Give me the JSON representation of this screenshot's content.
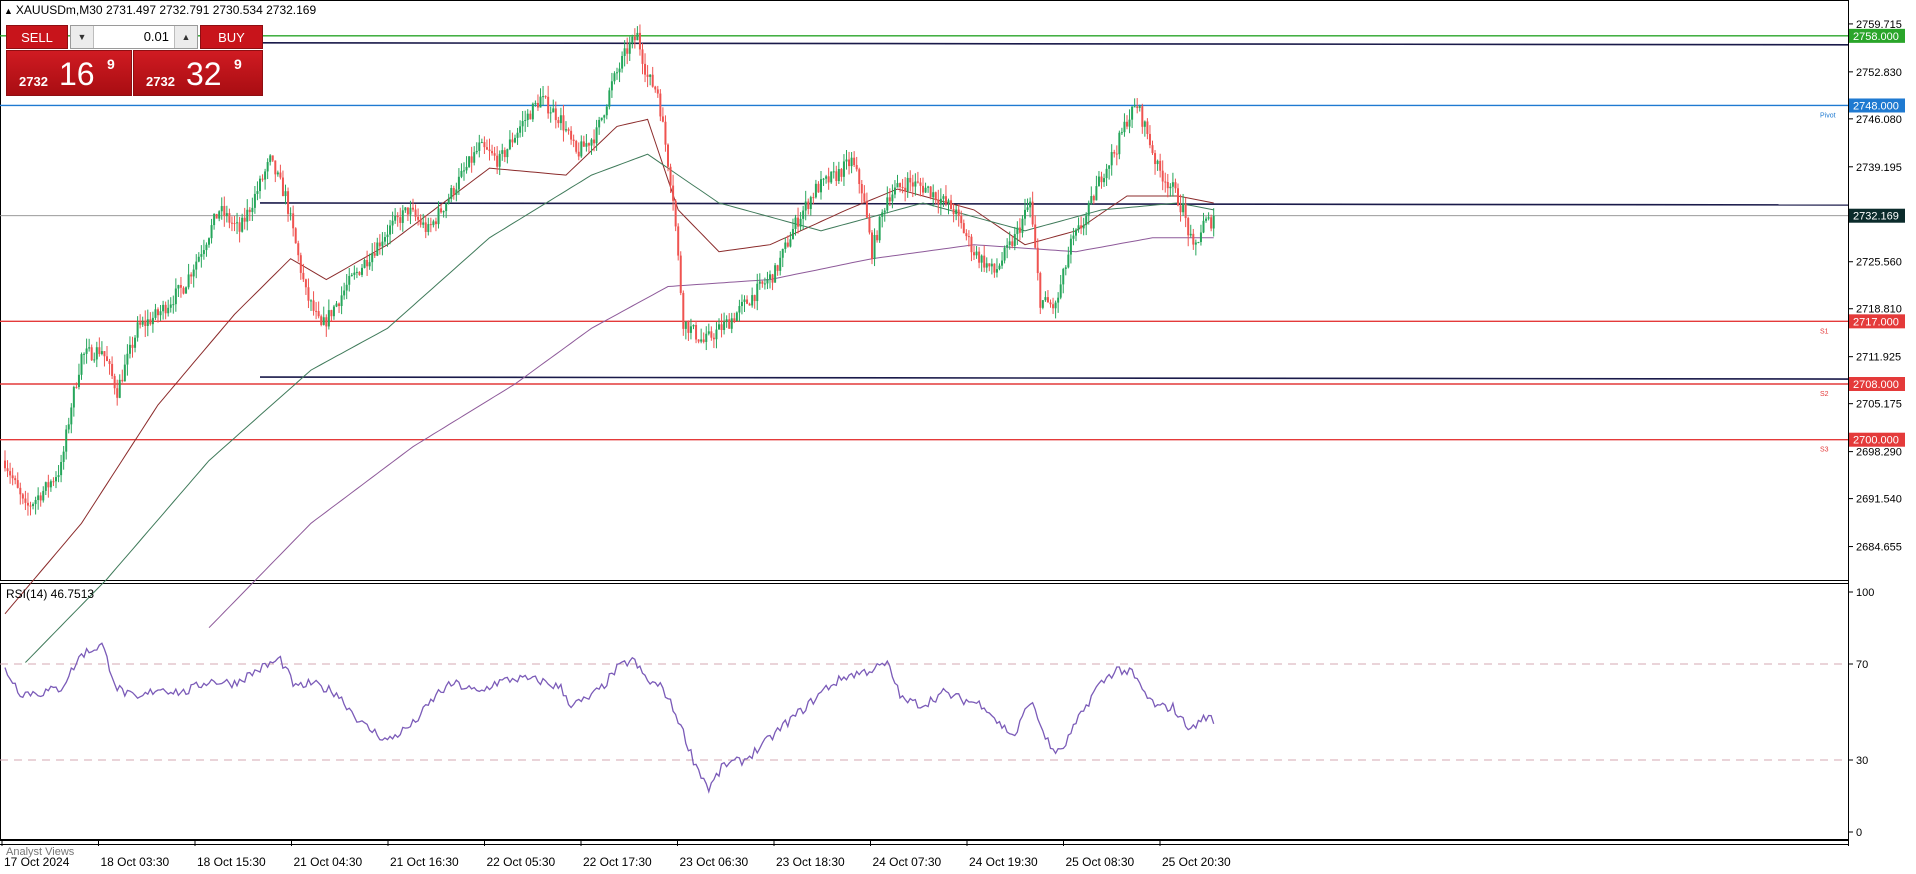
{
  "header": {
    "symbol_line": "XAUUSDm,M30  2731.497 2732.791 2730.534 2732.169"
  },
  "trade_panel": {
    "sell_label": "SELL",
    "buy_label": "BUY",
    "lot_value": "0.01",
    "sell_small": "2732",
    "sell_big": "16",
    "sell_sup": "9",
    "buy_small": "2732",
    "buy_big": "32",
    "buy_sup": "9"
  },
  "price_axis": {
    "ticks": [
      "2759.715",
      "2752.830",
      "2746.080",
      "2739.195",
      "2725.560",
      "2718.810",
      "2711.925",
      "2705.175",
      "2698.290",
      "2691.540",
      "2684.655"
    ]
  },
  "levels": [
    {
      "label": "2758.000",
      "price": 2758.0,
      "color": "#2aa52a",
      "text_label": ""
    },
    {
      "label": "2748.000",
      "price": 2748.0,
      "color": "#1f7ad1",
      "text_label": "Pivot"
    },
    {
      "label": "2717.000",
      "price": 2717.0,
      "color": "#e43a3a",
      "text_label": "S1"
    },
    {
      "label": "2708.000",
      "price": 2708.0,
      "color": "#e43a3a",
      "text_label": "S2"
    },
    {
      "label": "2700.000",
      "price": 2700.0,
      "color": "#e43a3a",
      "text_label": "S3"
    }
  ],
  "current_price": {
    "label": "2732.169",
    "price": 2732.169
  },
  "rsi": {
    "title": "RSI(14) 46.7513",
    "ticks": [
      "100",
      "70",
      "30",
      "0"
    ]
  },
  "time_axis": {
    "labels": [
      "17 Oct 2024",
      "18 Oct 03:30",
      "18 Oct 15:30",
      "21 Oct 04:30",
      "21 Oct 16:30",
      "22 Oct 05:30",
      "22 Oct 17:30",
      "23 Oct 06:30",
      "23 Oct 18:30",
      "24 Oct 07:30",
      "24 Oct 19:30",
      "25 Oct 08:30",
      "25 Oct 20:30"
    ]
  },
  "footer": {
    "analyst_label": "Analyst Views"
  },
  "colors": {
    "bull": "#26a65b",
    "bear": "#ef5350",
    "rsi": "#7b5bb8",
    "ma_fast": "#8b2b2b",
    "ma_mid": "#3f7a5a",
    "ma_slow": "#8e5a9a"
  },
  "chart_data": {
    "type": "candlestick",
    "symbol": "XAUUSDm",
    "timeframe": "M30",
    "anchors": [
      [
        0,
        2697
      ],
      [
        8,
        2690
      ],
      [
        16,
        2693
      ],
      [
        22,
        2696
      ],
      [
        26,
        2705
      ],
      [
        30,
        2712
      ],
      [
        38,
        2713
      ],
      [
        44,
        2707
      ],
      [
        52,
        2716
      ],
      [
        60,
        2718
      ],
      [
        70,
        2722
      ],
      [
        78,
        2728
      ],
      [
        84,
        2733
      ],
      [
        92,
        2730
      ],
      [
        98,
        2735
      ],
      [
        104,
        2740
      ],
      [
        110,
        2735
      ],
      [
        118,
        2721
      ],
      [
        124,
        2716
      ],
      [
        134,
        2722
      ],
      [
        142,
        2726
      ],
      [
        150,
        2730
      ],
      [
        158,
        2733
      ],
      [
        166,
        2730
      ],
      [
        176,
        2736
      ],
      [
        186,
        2742
      ],
      [
        194,
        2740
      ],
      [
        202,
        2745
      ],
      [
        210,
        2749
      ],
      [
        218,
        2746
      ],
      [
        224,
        2741
      ],
      [
        232,
        2744
      ],
      [
        238,
        2751
      ],
      [
        244,
        2756
      ],
      [
        248,
        2758
      ],
      [
        252,
        2752
      ],
      [
        256,
        2750
      ],
      [
        262,
        2735
      ],
      [
        266,
        2717
      ],
      [
        274,
        2714
      ],
      [
        284,
        2717
      ],
      [
        294,
        2721
      ],
      [
        302,
        2724
      ],
      [
        310,
        2731
      ],
      [
        318,
        2736
      ],
      [
        326,
        2738
      ],
      [
        332,
        2740
      ],
      [
        336,
        2736
      ],
      [
        340,
        2727
      ],
      [
        346,
        2735
      ],
      [
        354,
        2737
      ],
      [
        362,
        2736
      ],
      [
        372,
        2733
      ],
      [
        380,
        2727
      ],
      [
        388,
        2724
      ],
      [
        396,
        2729
      ],
      [
        402,
        2734
      ],
      [
        406,
        2720
      ],
      [
        412,
        2719
      ],
      [
        418,
        2728
      ],
      [
        424,
        2732
      ],
      [
        430,
        2738
      ],
      [
        436,
        2742
      ],
      [
        440,
        2746
      ],
      [
        444,
        2748
      ],
      [
        448,
        2744
      ],
      [
        452,
        2739
      ],
      [
        458,
        2736
      ],
      [
        462,
        2733
      ],
      [
        466,
        2727
      ],
      [
        470,
        2731
      ],
      [
        474,
        2731.5
      ]
    ],
    "ma_fast_anchors": [
      [
        0,
        2675
      ],
      [
        30,
        2688
      ],
      [
        60,
        2705
      ],
      [
        90,
        2718
      ],
      [
        112,
        2726
      ],
      [
        126,
        2723
      ],
      [
        150,
        2728
      ],
      [
        190,
        2739
      ],
      [
        220,
        2738
      ],
      [
        240,
        2745
      ],
      [
        252,
        2746
      ],
      [
        264,
        2733
      ],
      [
        280,
        2727
      ],
      [
        300,
        2728
      ],
      [
        330,
        2733
      ],
      [
        350,
        2736
      ],
      [
        380,
        2733
      ],
      [
        400,
        2728
      ],
      [
        420,
        2730
      ],
      [
        440,
        2735
      ],
      [
        460,
        2735
      ],
      [
        474,
        2734
      ]
    ],
    "ma_mid_anchors": [
      [
        8,
        2668
      ],
      [
        40,
        2680
      ],
      [
        80,
        2697
      ],
      [
        120,
        2710
      ],
      [
        150,
        2716
      ],
      [
        190,
        2729
      ],
      [
        230,
        2738
      ],
      [
        252,
        2741
      ],
      [
        280,
        2734
      ],
      [
        320,
        2730
      ],
      [
        360,
        2734
      ],
      [
        400,
        2730
      ],
      [
        430,
        2733
      ],
      [
        460,
        2734
      ],
      [
        474,
        2733
      ]
    ],
    "ma_slow_anchors": [
      [
        80,
        2673
      ],
      [
        120,
        2688
      ],
      [
        160,
        2699
      ],
      [
        200,
        2708
      ],
      [
        230,
        2716
      ],
      [
        260,
        2722
      ],
      [
        300,
        2723
      ],
      [
        340,
        2726
      ],
      [
        380,
        2728
      ],
      [
        420,
        2727
      ],
      [
        450,
        2729
      ],
      [
        474,
        2729
      ]
    ],
    "rsi_anchors": [
      [
        0,
        68
      ],
      [
        6,
        58
      ],
      [
        14,
        58
      ],
      [
        22,
        60
      ],
      [
        30,
        74
      ],
      [
        38,
        78
      ],
      [
        44,
        60
      ],
      [
        52,
        55
      ],
      [
        60,
        60
      ],
      [
        70,
        58
      ],
      [
        80,
        63
      ],
      [
        90,
        62
      ],
      [
        100,
        68
      ],
      [
        108,
        72
      ],
      [
        114,
        60
      ],
      [
        120,
        62
      ],
      [
        130,
        58
      ],
      [
        140,
        45
      ],
      [
        150,
        38
      ],
      [
        160,
        45
      ],
      [
        170,
        58
      ],
      [
        176,
        62
      ],
      [
        186,
        58
      ],
      [
        192,
        62
      ],
      [
        200,
        64
      ],
      [
        210,
        63
      ],
      [
        218,
        60
      ],
      [
        222,
        53
      ],
      [
        228,
        55
      ],
      [
        234,
        60
      ],
      [
        240,
        68
      ],
      [
        246,
        72
      ],
      [
        252,
        63
      ],
      [
        258,
        60
      ],
      [
        264,
        47
      ],
      [
        270,
        30
      ],
      [
        276,
        18
      ],
      [
        282,
        28
      ],
      [
        290,
        30
      ],
      [
        298,
        37
      ],
      [
        306,
        45
      ],
      [
        314,
        52
      ],
      [
        322,
        60
      ],
      [
        330,
        65
      ],
      [
        338,
        67
      ],
      [
        346,
        70
      ],
      [
        352,
        55
      ],
      [
        360,
        53
      ],
      [
        368,
        58
      ],
      [
        376,
        55
      ],
      [
        384,
        53
      ],
      [
        390,
        45
      ],
      [
        396,
        40
      ],
      [
        402,
        55
      ],
      [
        410,
        35
      ],
      [
        414,
        33
      ],
      [
        420,
        45
      ],
      [
        428,
        60
      ],
      [
        436,
        68
      ],
      [
        442,
        66
      ],
      [
        448,
        56
      ],
      [
        452,
        52
      ],
      [
        458,
        52
      ],
      [
        462,
        46
      ],
      [
        466,
        43
      ],
      [
        470,
        48
      ],
      [
        474,
        47
      ]
    ],
    "rsi_levels": [
      70,
      30
    ],
    "y_range": [
      2681,
      2762
    ]
  }
}
